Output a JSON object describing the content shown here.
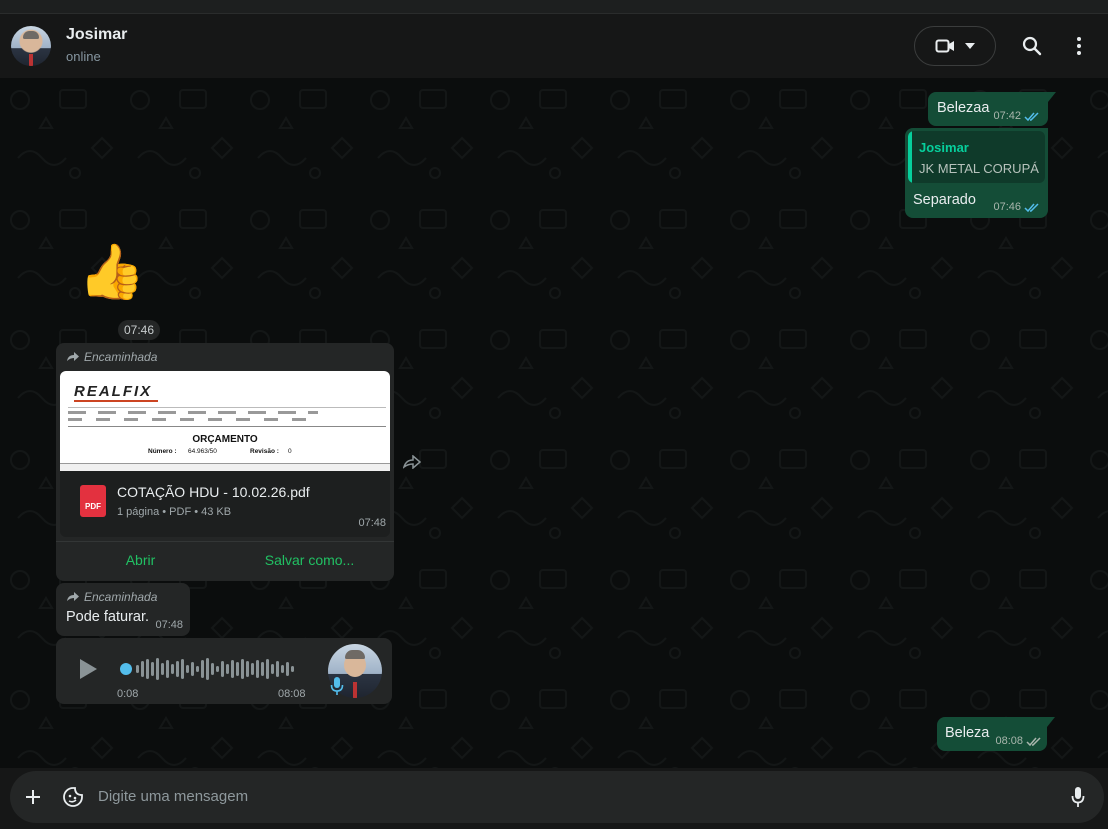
{
  "header": {
    "contact_name": "Josimar",
    "status": "online"
  },
  "messages": {
    "out_1": {
      "text": "Belezaa",
      "time": "07:42"
    },
    "out_2": {
      "quote_author": "Josimar",
      "quote_text": "JK METAL CORUPÁ",
      "text": "Separado",
      "time": "07:46"
    },
    "sticker": {
      "emoji": "👍",
      "time": "07:46"
    },
    "doc": {
      "forwarded_label": "Encaminhada",
      "preview": {
        "logo": "REALFIX",
        "title": "ORÇAMENTO",
        "numero_label": "Número :",
        "numero": "64.963/50",
        "revisao_label": "Revisão :",
        "revisao": "0"
      },
      "file_name": "COTAÇÃO HDU - 10.02.26.pdf",
      "file_meta": "1 página • PDF • 43 KB",
      "badge": "PDF",
      "time": "07:48",
      "open_label": "Abrir",
      "save_label": "Salvar como..."
    },
    "in_text": {
      "forwarded_label": "Encaminhada",
      "text": "Pode faturar.",
      "time": "07:48"
    },
    "voice": {
      "position": "0:08",
      "duration": "08:08",
      "progress": 0.0
    },
    "out_3": {
      "text": "Beleza",
      "time": "08:08"
    }
  },
  "composer": {
    "placeholder": "Digite uma mensagem"
  },
  "colors": {
    "outgoing_bubble": "#144d37",
    "incoming_bubble": "#242626",
    "accent": "#21c063",
    "read_ticks": "#53bdeb"
  },
  "icons": [
    "video-icon",
    "chevron-down-icon",
    "search-icon",
    "menu-icon",
    "forward-icon",
    "play-icon",
    "mic-icon",
    "plus-icon",
    "sticker-icon"
  ]
}
